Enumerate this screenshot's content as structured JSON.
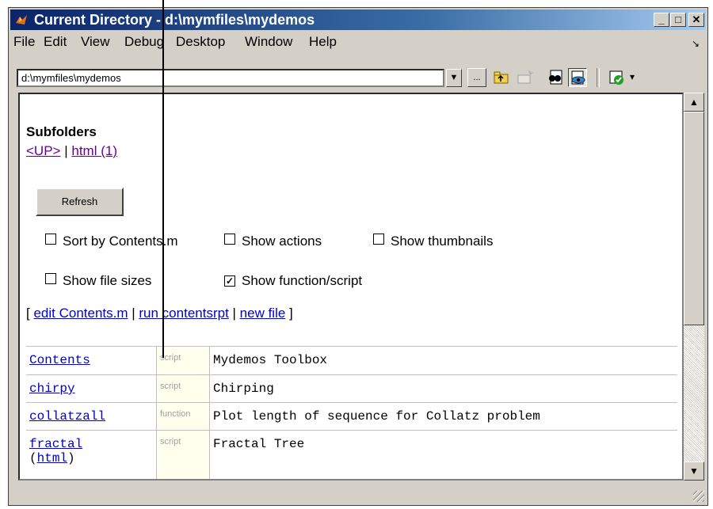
{
  "window": {
    "title": "Current Directory - d:\\mymfiles\\mydemos",
    "controls": {
      "minimize": "_",
      "maximize": "□",
      "close": "✕"
    }
  },
  "menubar": {
    "items": [
      {
        "label": "File"
      },
      {
        "label": "Edit"
      },
      {
        "label": "View"
      },
      {
        "label": "Debug"
      },
      {
        "label": "Desktop"
      },
      {
        "label": "Window"
      },
      {
        "label": "Help"
      }
    ],
    "overflow": "↘"
  },
  "toolbar": {
    "path_value": "d:\\mymfiles\\mydemos",
    "browse_label": "...",
    "icons": [
      "up-folder-icon",
      "new-folder-icon",
      "find-files-icon",
      "show-browser-icon",
      "run-reports-icon"
    ]
  },
  "content": {
    "subfolders_heading": "Subfolders",
    "subfolder_links": {
      "up": "<UP>",
      "separator": " | ",
      "html": "html (1)"
    },
    "refresh_label": "Refresh",
    "options": {
      "sort_by_contents": {
        "label": "Sort by Contents.m",
        "checked": false
      },
      "show_actions": {
        "label": "Show actions",
        "checked": false
      },
      "show_thumbnails": {
        "label": "Show thumbnails",
        "checked": false
      },
      "show_file_sizes": {
        "label": "Show file sizes",
        "checked": false
      },
      "show_function_script": {
        "label": "Show function/script",
        "checked": true
      }
    },
    "actions": {
      "open_bracket": "[ ",
      "edit_contents": "edit Contents.m",
      "sep1": " | ",
      "run_contentsrpt": "run contentsrpt",
      "sep2": " | ",
      "new_file": "new file",
      "close_bracket": " ]"
    },
    "files": [
      {
        "name": "Contents",
        "kind": "script",
        "description": "Mydemos Toolbox"
      },
      {
        "name": "chirpy",
        "kind": "script",
        "description": "Chirping"
      },
      {
        "name": "collatzall",
        "kind": "function",
        "description": "Plot length of sequence for Collatz problem"
      },
      {
        "name": "fractal",
        "kind": "script",
        "description": "Fractal Tree",
        "extra": {
          "open": "(",
          "link": "html",
          "close": ")"
        }
      }
    ]
  },
  "colors": {
    "titlebar_start": "#0a246a",
    "titlebar_end": "#a6caf0",
    "chrome": "#d4d0c8",
    "visited_link": "#660099",
    "link": "#0000cc",
    "kind_cell_bg": "#ffffee"
  }
}
